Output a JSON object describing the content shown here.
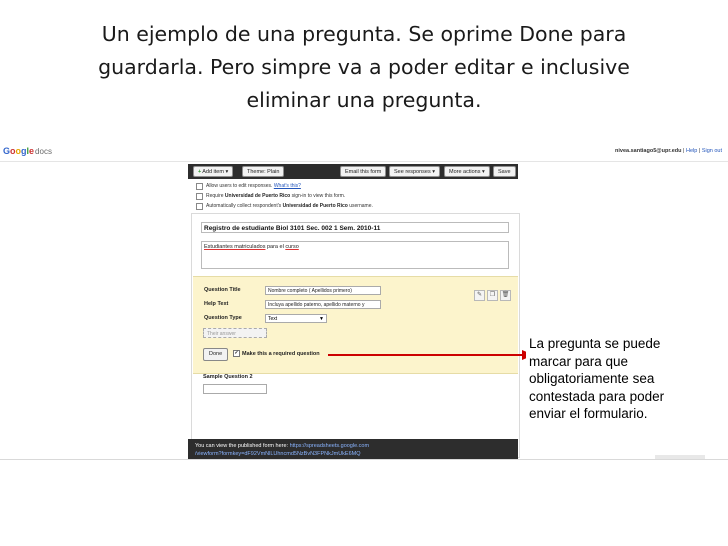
{
  "slide": {
    "title_lines": [
      "Un ejemplo de una pregunta.  Se oprime Done para",
      "guardarla.  Pero simpre va a poder editar e inclusive",
      "eliminar una pregunta."
    ]
  },
  "app": {
    "logo_google": [
      "G",
      "o",
      "o",
      "g",
      "l",
      "e"
    ],
    "logo_docs": "docs",
    "user_email": "nivea.santiago5@upr.edu",
    "link_help": "Help",
    "link_signout": "Sign out"
  },
  "toolbar": {
    "add_item": "Add item",
    "theme": "Theme: Plain",
    "email_form": "Email this form",
    "see_responses": "See responses",
    "more_actions": "More actions",
    "save": "Save"
  },
  "options": [
    {
      "text": "Allow users to edit responses.",
      "link": "What's this?"
    },
    {
      "pre": "Require",
      "bold": "Universidad de Puerto Rico",
      "post": "sign-in to view this form."
    },
    {
      "pre": "Automatically collect respondent's",
      "bold": "Universidad de Puerto Rico",
      "post": "username."
    }
  ],
  "form": {
    "title": "Registro de estudiante Biol 3101 Sec. 002 1 Sem. 2010-11",
    "description_underlined": "Estudiantes matriculados",
    "description_rest": " para el ",
    "description_word": "curso",
    "question": {
      "title_label": "Question Title",
      "title_value": "Nombre completo ( Apellidos primero)",
      "help_label": "Help Text",
      "help_value": "Incluya apellido paterno, apellido materno y",
      "type_label": "Question Type",
      "type_value": "Text",
      "answer_placeholder": "Their answer",
      "done": "Done",
      "required_label": "Make this a required question"
    },
    "sample_question": "Sample Question 2"
  },
  "published": {
    "prefix": "You can view the published form here: ",
    "url_part1": "https://spreadsheets.google.com",
    "url_part2": "/viewform?formkey=dF92VmNlLUhncmd5NzBvN3FPNkJmUkE6MQ"
  },
  "annotation": "La pregunta se puede marcar para que obligatoriamente sea contestada para poder enviar el formulario.",
  "colors": {
    "question_panel": "#fcf4cc",
    "toolbar": "#2d2d2d",
    "arrow": "#cc0000"
  }
}
